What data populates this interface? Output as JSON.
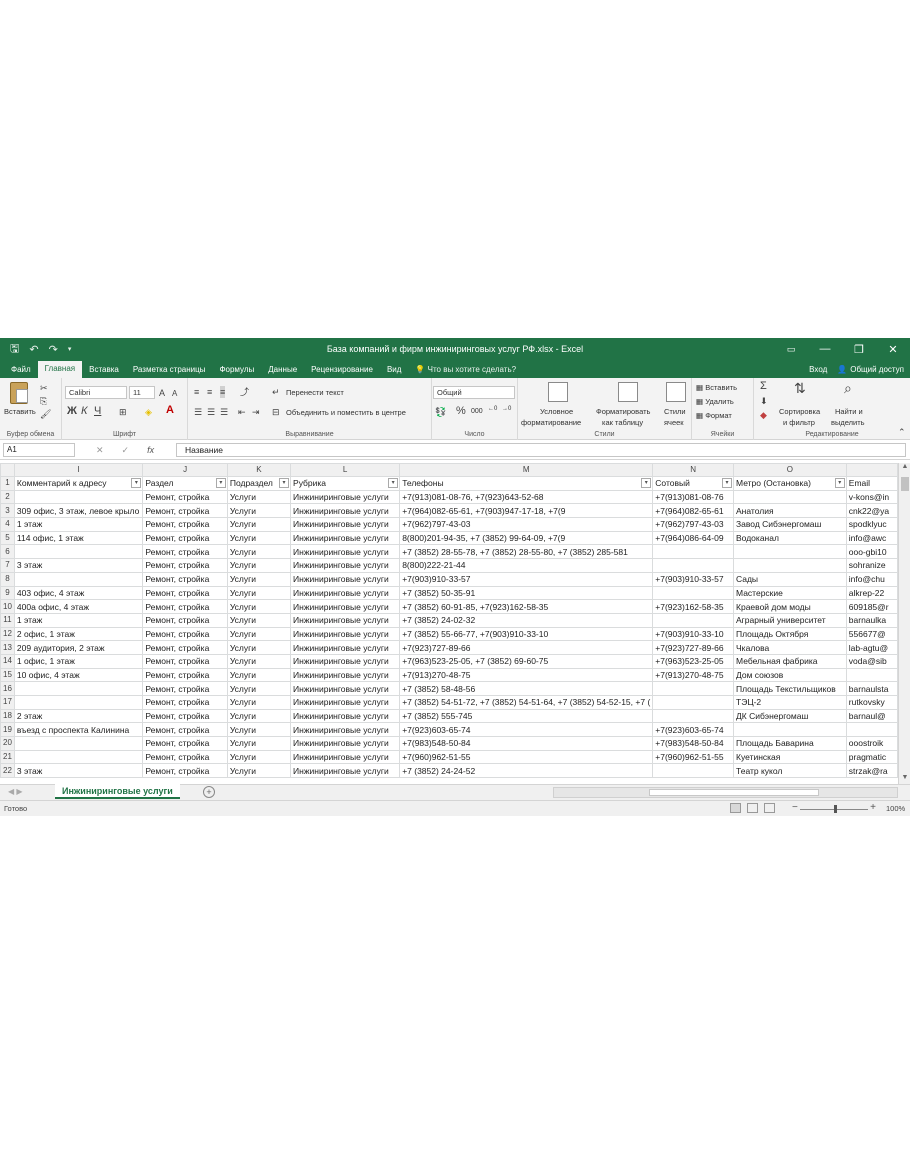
{
  "window": {
    "title": "База компаний и фирм инжиниринговых услуг РФ.xlsx - Excel",
    "save_icon": "save-icon",
    "undo_icon": "undo-icon",
    "redo_icon": "redo-icon",
    "minimize": "—",
    "restore": "❐",
    "close": "✕"
  },
  "tabs": {
    "items": [
      "Файл",
      "Главная",
      "Вставка",
      "Разметка страницы",
      "Формулы",
      "Данные",
      "Рецензирование",
      "Вид"
    ],
    "active_index": 1,
    "tell_me": "Что вы хотите сделать?",
    "sign_in": "Вход",
    "share": "Общий доступ"
  },
  "ribbon": {
    "clipboard": {
      "paste": "Вставить",
      "label": "Буфер обмена"
    },
    "font": {
      "name": "Calibri",
      "size": "11",
      "bold": "Ж",
      "italic": "К",
      "underline": "Ч",
      "label": "Шрифт"
    },
    "alignment": {
      "wrap": "Перенести текст",
      "merge": "Объединить и поместить в центре",
      "label": "Выравнивание"
    },
    "number": {
      "format": "Общий",
      "percent": "%",
      "thousands": "000",
      "label": "Число"
    },
    "styles": {
      "conditional_1": "Условное",
      "conditional_2": "форматирование",
      "as_table_1": "Форматировать",
      "as_table_2": "как таблицу",
      "cell_styles_1": "Стили",
      "cell_styles_2": "ячеек",
      "label": "Стили"
    },
    "cells": {
      "insert": "Вставить",
      "delete": "Удалить",
      "format": "Формат",
      "label": "Ячейки"
    },
    "editing": {
      "sum": "Σ",
      "sort_1": "Сортировка",
      "sort_2": "и фильтр",
      "find_1": "Найти и",
      "find_2": "выделить",
      "label": "Редактирование"
    }
  },
  "formula_bar": {
    "name_box": "A1",
    "fx": "fx",
    "value": "Название"
  },
  "grid": {
    "columns": [
      "I",
      "J",
      "K",
      "L",
      "M",
      "N",
      "O"
    ],
    "rows": [
      {
        "n": "1",
        "c": [
          "Комментарий к адресу",
          "Раздел",
          "Подраздел",
          "Рубрика",
          "Телефоны",
          "Сотовый",
          "Метро (Остановка)",
          "Email"
        ]
      },
      {
        "n": "2",
        "c": [
          "",
          "Ремонт, стройка",
          "Услуги",
          "Инжиниринговые услуги",
          "+7(913)081-08-76, +7(923)643-52-68",
          "+7(913)081-08-76",
          "",
          "v-kons@in"
        ]
      },
      {
        "n": "3",
        "c": [
          "309 офис, 3 этаж, левое крыло",
          "Ремонт, стройка",
          "Услуги",
          "Инжиниринговые услуги",
          "+7(964)082-65-61, +7(903)947-17-18, +7(9",
          "+7(964)082-65-61",
          "Анатолия",
          "cnk22@ya"
        ]
      },
      {
        "n": "4",
        "c": [
          "1 этаж",
          "Ремонт, стройка",
          "Услуги",
          "Инжиниринговые услуги",
          "+7(962)797-43-03",
          "+7(962)797-43-03",
          "Завод Сибэнергомаш",
          "spodklyuc"
        ]
      },
      {
        "n": "5",
        "c": [
          "114 офис, 1 этаж",
          "Ремонт, стройка",
          "Услуги",
          "Инжиниринговые услуги",
          "8(800)201-94-35, +7 (3852) 99-64-09, +7(9",
          "+7(964)086-64-09",
          "Водоканал",
          "info@awc"
        ]
      },
      {
        "n": "6",
        "c": [
          "",
          "Ремонт, стройка",
          "Услуги",
          "Инжиниринговые услуги",
          "+7 (3852) 28-55-78, +7 (3852) 28-55-80, +7 (3852) 285-581",
          "",
          "",
          "ooo-gbi10"
        ]
      },
      {
        "n": "7",
        "c": [
          "3 этаж",
          "Ремонт, стройка",
          "Услуги",
          "Инжиниринговые услуги",
          "8(800)222-21-44",
          "",
          "",
          "sohranize"
        ]
      },
      {
        "n": "8",
        "c": [
          "",
          "Ремонт, стройка",
          "Услуги",
          "Инжиниринговые услуги",
          "+7(903)910-33-57",
          "+7(903)910-33-57",
          "Сады",
          "info@chu"
        ]
      },
      {
        "n": "9",
        "c": [
          "403 офис, 4 этаж",
          "Ремонт, стройка",
          "Услуги",
          "Инжиниринговые услуги",
          "+7 (3852) 50-35-91",
          "",
          "Мастерские",
          "alkrep-22"
        ]
      },
      {
        "n": "10",
        "c": [
          "400а офис, 4 этаж",
          "Ремонт, стройка",
          "Услуги",
          "Инжиниринговые услуги",
          "+7 (3852) 60-91-85, +7(923)162-58-35",
          "+7(923)162-58-35",
          "Краевой дом моды",
          "609185@r"
        ]
      },
      {
        "n": "11",
        "c": [
          "1 этаж",
          "Ремонт, стройка",
          "Услуги",
          "Инжиниринговые услуги",
          "+7 (3852) 24-02-32",
          "",
          "Аграрный университет",
          "barnaulka"
        ]
      },
      {
        "n": "12",
        "c": [
          "2 офис, 1 этаж",
          "Ремонт, стройка",
          "Услуги",
          "Инжиниринговые услуги",
          "+7 (3852) 55-66-77, +7(903)910-33-10",
          "+7(903)910-33-10",
          "Площадь Октября",
          "556677@"
        ]
      },
      {
        "n": "13",
        "c": [
          "209 аудитория, 2 этаж",
          "Ремонт, стройка",
          "Услуги",
          "Инжиниринговые услуги",
          "+7(923)727-89-66",
          "+7(923)727-89-66",
          "Чкалова",
          "lab-agtu@"
        ]
      },
      {
        "n": "14",
        "c": [
          "1 офис, 1 этаж",
          "Ремонт, стройка",
          "Услуги",
          "Инжиниринговые услуги",
          "+7(963)523-25-05, +7 (3852) 69-60-75",
          "+7(963)523-25-05",
          "Мебельная фабрика",
          "voda@sib"
        ]
      },
      {
        "n": "15",
        "c": [
          "10 офис, 4 этаж",
          "Ремонт, стройка",
          "Услуги",
          "Инжиниринговые услуги",
          "+7(913)270-48-75",
          "+7(913)270-48-75",
          "Дом союзов",
          ""
        ]
      },
      {
        "n": "16",
        "c": [
          "",
          "Ремонт, стройка",
          "Услуги",
          "Инжиниринговые услуги",
          "+7 (3852) 58-48-56",
          "",
          "Площадь Текстильщиков",
          "barnaulsta"
        ]
      },
      {
        "n": "17",
        "c": [
          "",
          "Ремонт, стройка",
          "Услуги",
          "Инжиниринговые услуги",
          "+7 (3852) 54-51-72, +7 (3852) 54-51-64, +7 (3852) 54-52-15, +7 (",
          "",
          "ТЭЦ-2",
          "rutkovsky"
        ]
      },
      {
        "n": "18",
        "c": [
          "2 этаж",
          "Ремонт, стройка",
          "Услуги",
          "Инжиниринговые услуги",
          "+7 (3852) 555-745",
          "",
          "ДК Сибэнергомаш",
          "barnaul@"
        ]
      },
      {
        "n": "19",
        "c": [
          "въезд с проспекта Калинина",
          "Ремонт, стройка",
          "Услуги",
          "Инжиниринговые услуги",
          "+7(923)603-65-74",
          "+7(923)603-65-74",
          "",
          ""
        ]
      },
      {
        "n": "20",
        "c": [
          "",
          "Ремонт, стройка",
          "Услуги",
          "Инжиниринговые услуги",
          "+7(983)548-50-84",
          "+7(983)548-50-84",
          "Площадь Баварина",
          "ooostroik"
        ]
      },
      {
        "n": "21",
        "c": [
          "",
          "Ремонт, стройка",
          "Услуги",
          "Инжиниринговые услуги",
          "+7(960)962-51-55",
          "+7(960)962-51-55",
          "Куетинская",
          "pragmatic"
        ]
      },
      {
        "n": "22",
        "c": [
          "3 этаж",
          "Ремонт, стройка",
          "Услуги",
          "Инжиниринговые услуги",
          "+7 (3852) 24-24-52",
          "",
          "Театр кукол",
          "strzak@ra"
        ]
      }
    ]
  },
  "sheet_tabs": {
    "active": "Инжиниринговые услуги",
    "add": "+"
  },
  "status": {
    "ready": "Готово",
    "zoom": "100%"
  }
}
